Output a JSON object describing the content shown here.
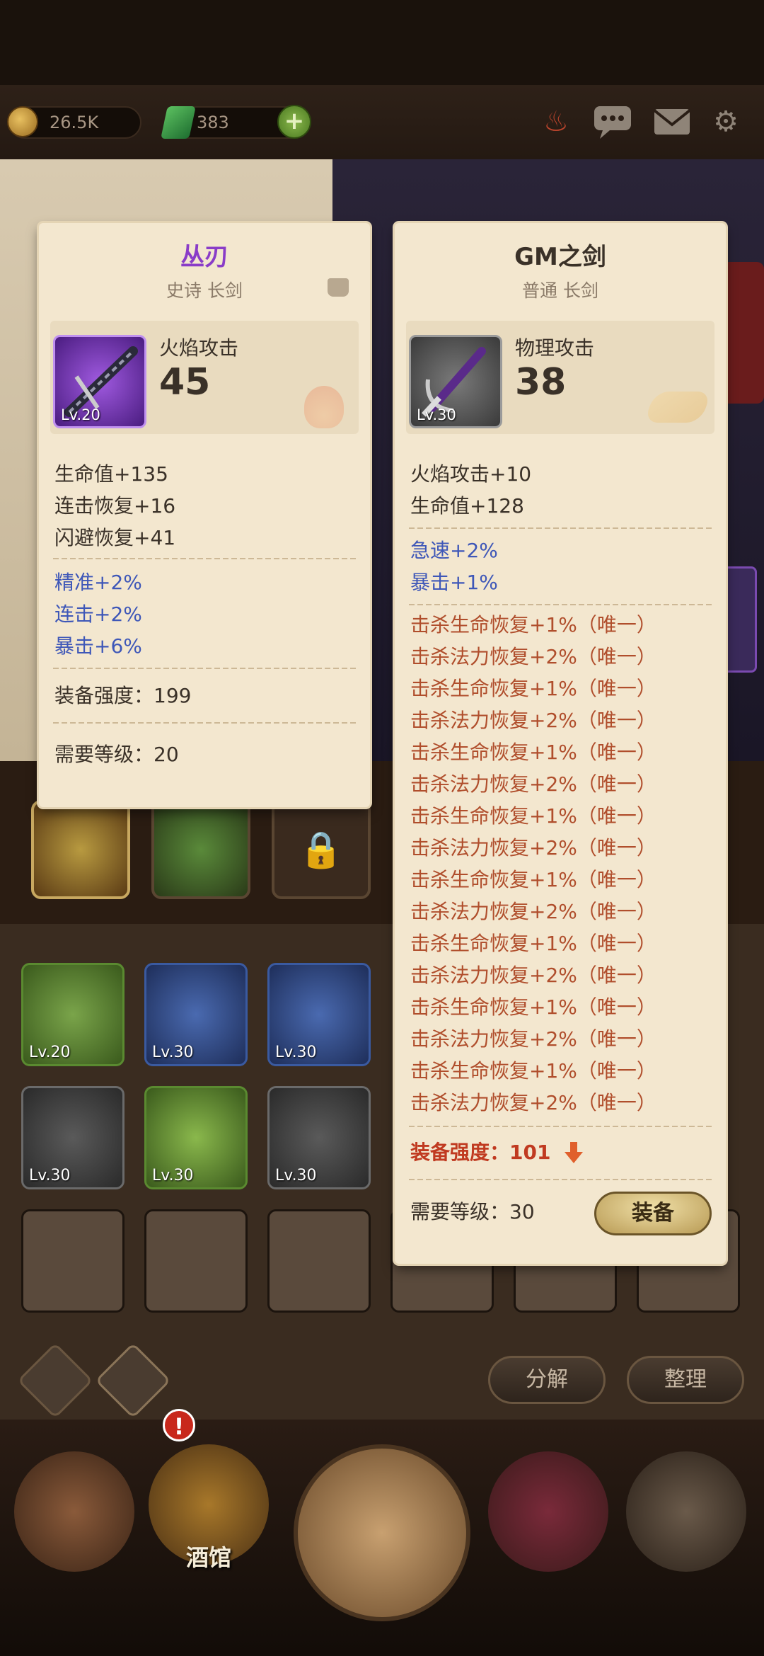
{
  "topbar": {
    "gold": "26.5K",
    "gems": "383"
  },
  "nav": {
    "tavern_label": "酒馆"
  },
  "inventory": {
    "slots": [
      {
        "level": "Lv.20"
      },
      {
        "level": "Lv.30"
      },
      {
        "level": "Lv.30"
      },
      {
        "level": "Lv.30"
      },
      {
        "level": "Lv.30"
      },
      {
        "level": "Lv.30"
      }
    ],
    "decompose_label": "分解",
    "sort_label": "整理"
  },
  "left_card": {
    "name": "丛刃",
    "subtitle": "史诗 长剑",
    "level": "Lv.20",
    "main_stat_name": "火焰攻击",
    "main_stat_value": "45",
    "base_stats": [
      "生命值+135",
      "连击恢复+16",
      "闪避恢复+41"
    ],
    "bonus_stats": [
      "精准+2%",
      "连击+2%",
      "暴击+6%"
    ],
    "power_label": "装备强度：199",
    "req_label": "需要等级：20"
  },
  "right_card": {
    "name": "GM之剑",
    "subtitle": "普通 长剑",
    "level": "Lv.30",
    "main_stat_name": "物理攻击",
    "main_stat_value": "38",
    "base_stats": [
      "火焰攻击+10",
      "生命值+128"
    ],
    "bonus_stats": [
      "急速+2%",
      "暴击+1%"
    ],
    "unique_stats": [
      "击杀生命恢复+1%（唯一）",
      "击杀法力恢复+2%（唯一）",
      "击杀生命恢复+1%（唯一）",
      "击杀法力恢复+2%（唯一）",
      "击杀生命恢复+1%（唯一）",
      "击杀法力恢复+2%（唯一）",
      "击杀生命恢复+1%（唯一）",
      "击杀法力恢复+2%（唯一）",
      "击杀生命恢复+1%（唯一）",
      "击杀法力恢复+2%（唯一）",
      "击杀生命恢复+1%（唯一）",
      "击杀法力恢复+2%（唯一）",
      "击杀生命恢复+1%（唯一）",
      "击杀法力恢复+2%（唯一）",
      "击杀生命恢复+1%（唯一）",
      "击杀法力恢复+2%（唯一）"
    ],
    "power_label": "装备强度：101",
    "req_label": "需要等级：30",
    "equip_label": "装备"
  },
  "colors": {
    "epic": "#8a3cc8",
    "blue_stat": "#3e57b8",
    "unique_stat": "#b04e2c",
    "power_down": "#c03a20"
  }
}
